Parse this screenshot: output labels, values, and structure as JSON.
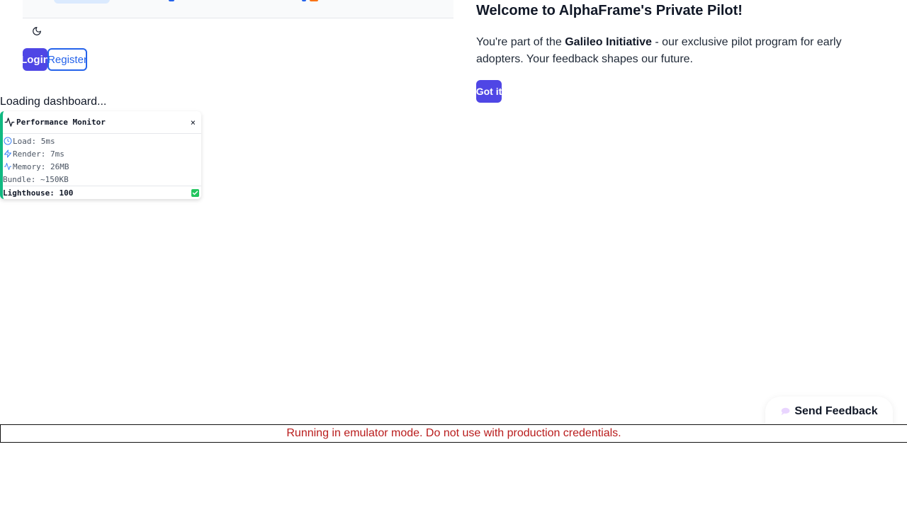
{
  "nav": {
    "theme_toggle_icon": "moon-icon"
  },
  "auth": {
    "login_label": "Login",
    "register_label": "Register"
  },
  "status": {
    "loading_text": "Loading dashboard..."
  },
  "perf_monitor": {
    "title": "Performance Monitor",
    "close_label": "×",
    "load": "Load: 5ms",
    "render": "Render: 7ms",
    "memory": "Memory: 26MB",
    "bundle": "Bundle: ~150KB",
    "lighthouse": "Lighthouse: 100",
    "accent_color": "#10b981"
  },
  "welcome": {
    "title": "Welcome to AlphaFrame's Private Pilot!",
    "text_before": "You're part of the ",
    "initiative": "Galileo Initiative",
    "text_after": " - our exclusive pilot program for early adopters. Your feedback shapes our future.",
    "got_it_label": "Got it"
  },
  "feedback": {
    "label": "Send Feedback",
    "icon": "speech-bubble-icon"
  },
  "banner": {
    "text": "Running in emulator mode. Do not use with production credentials.",
    "color": "#b91c1c"
  },
  "colors": {
    "primary": "#4f46e5",
    "link": "#2563eb"
  }
}
